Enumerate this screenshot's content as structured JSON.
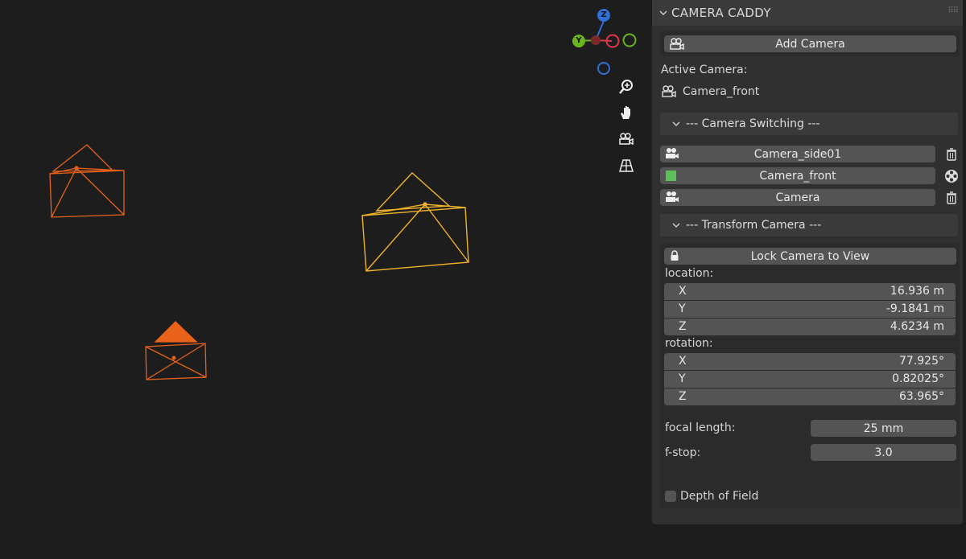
{
  "gizmo": {
    "z": "Z",
    "y": "Y"
  },
  "viewport_tools": [
    "zoom-icon",
    "pan-hand-icon",
    "camera-view-icon",
    "perspective-grid-icon"
  ],
  "panel": {
    "title": "CAMERA CADDY",
    "add_camera": "Add Camera",
    "active_camera_label": "Active Camera:",
    "active_camera_name": "Camera_front",
    "switching_header": "--- Camera Switching ---",
    "cameras": [
      {
        "name": "Camera_side01",
        "active": false,
        "action_icon": "trash-icon"
      },
      {
        "name": "Camera_front",
        "active": true,
        "action_icon": "film-reel-icon"
      },
      {
        "name": "Camera",
        "active": false,
        "action_icon": "trash-icon"
      }
    ],
    "transform_header": "--- Transform Camera ---",
    "lock_camera": "Lock Camera to View",
    "location_label": "location:",
    "location": [
      {
        "axis": "X",
        "value": "16.936 m"
      },
      {
        "axis": "Y",
        "value": "-9.1841 m"
      },
      {
        "axis": "Z",
        "value": "4.6234 m"
      }
    ],
    "rotation_label": "rotation:",
    "rotation": [
      {
        "axis": "X",
        "value": "77.925°"
      },
      {
        "axis": "Y",
        "value": "0.82025°"
      },
      {
        "axis": "Z",
        "value": "63.965°"
      }
    ],
    "focal_length_label": "focal length:",
    "focal_length_value": "25 mm",
    "fstop_label": "f-stop:",
    "fstop_value": "3.0",
    "dof_label": "Depth of Field",
    "dof_checked": false
  },
  "colors": {
    "camera_selected": "#e8621a",
    "camera_active": "#f0b32a",
    "active_indicator": "#5cbf5c",
    "x_axis": "#e0344a",
    "y_axis": "#6bb31f",
    "z_axis": "#2e70d6"
  }
}
